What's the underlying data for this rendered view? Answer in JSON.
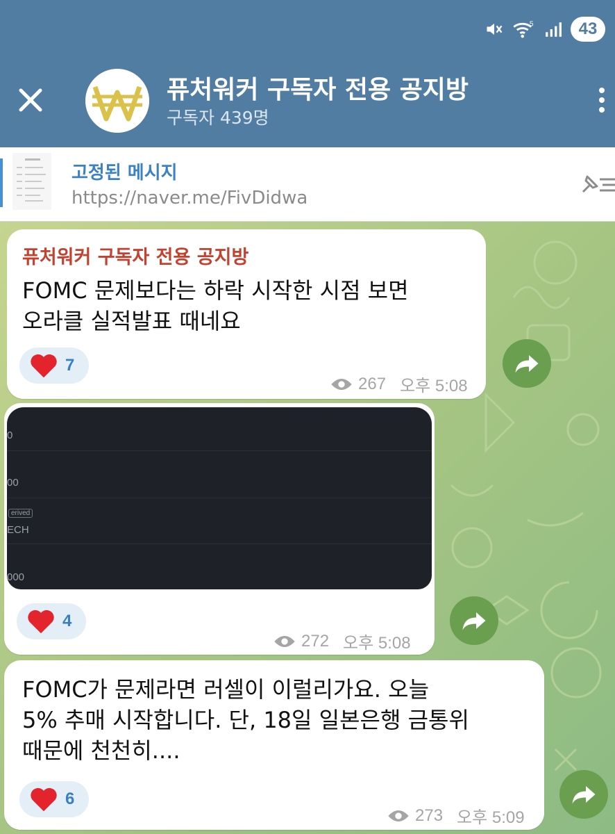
{
  "status_bar": {
    "battery": "43"
  },
  "header": {
    "title": "퓨처워커 구독자 전용 공지방",
    "subtitle": "구독자 439명"
  },
  "pinned": {
    "label": "고정된 메시지",
    "text": "https://naver.me/FivDidwa"
  },
  "messages": [
    {
      "sender": "퓨처워커 구독자 전용 공지방",
      "text": "FOMC 문제보다는 하락 시작한 시점 보면\n오라클 실적발표 때네요",
      "reaction_count": "7",
      "views": "267",
      "time": "오후 5:08"
    },
    {
      "image_ticks": [
        "0",
        "00",
        "ECH",
        "000"
      ],
      "image_tag": "erived",
      "reaction_count": "4",
      "views": "272",
      "time": "오후 5:08"
    },
    {
      "text": "FOMC가 문제라면 러셀이 이럴리가요. 오늘\n5% 추매 시작합니다. 단, 18일 일본은행 금통위\n때문에 천천히....",
      "reaction_count": "6",
      "views": "273",
      "time": "오후 5:09"
    }
  ],
  "icons": {
    "mute": "mute-icon",
    "wifi": "wifi-icon",
    "signal": "signal-icon",
    "close": "close-icon",
    "more": "more-vertical-icon",
    "pin": "pin-list-icon",
    "heart": "heart-icon",
    "views": "eye-icon",
    "share": "share-arrow-icon"
  },
  "colors": {
    "header": "#527da3",
    "sender": "#c2412f",
    "link": "#3b82c4",
    "reaction_bg": "#e4eef7",
    "share": "#6a9f4f",
    "heart": "#e4242d"
  }
}
